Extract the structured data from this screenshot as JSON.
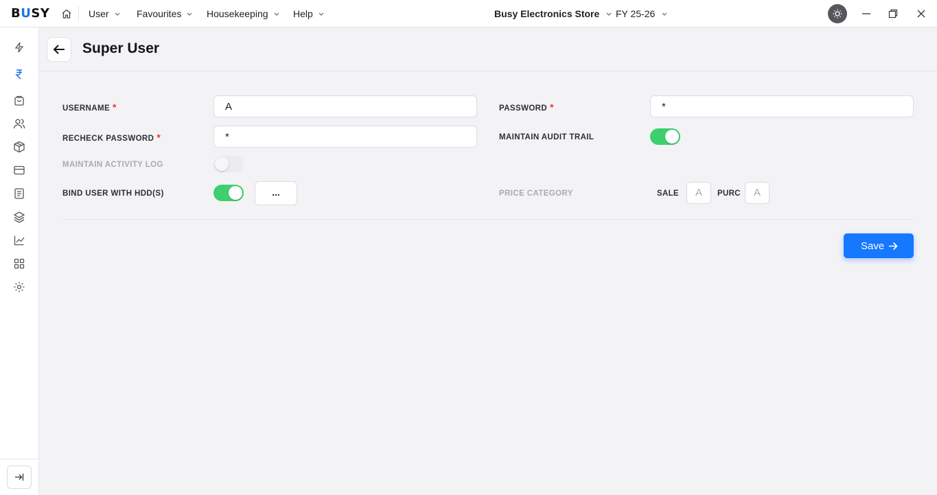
{
  "app": {
    "logo_prefix": "B",
    "logo_highlight": "U",
    "logo_suffix": "SY"
  },
  "menu": {
    "items": [
      {
        "label": "User"
      },
      {
        "label": "Favourites"
      },
      {
        "label": "Housekeeping"
      },
      {
        "label": "Help"
      }
    ],
    "company": "Busy Electronics Store",
    "fiscal_year": "FY 25-26"
  },
  "sidebar": {
    "icons": [
      "flash-icon",
      "rupee-icon",
      "shopping-bag-icon",
      "users-icon",
      "box-icon",
      "card-icon",
      "document-icon",
      "layers-icon",
      "chart-icon",
      "grid-icon",
      "gear-icon"
    ],
    "accent": "#1a73e8"
  },
  "page": {
    "title": "Super User"
  },
  "form": {
    "username": {
      "label": "USERNAME",
      "required_mark": "*",
      "value": "A"
    },
    "password": {
      "label": "PASSWORD",
      "required_mark": "*",
      "value": "*"
    },
    "recheck_password": {
      "label": "RECHECK PASSWORD",
      "required_mark": "*",
      "value": "*"
    },
    "audit_trail": {
      "label": "MAINTAIN AUDIT TRAIL",
      "enabled": true
    },
    "activity_log": {
      "label": "MAINTAIN ACTIVITY LOG",
      "enabled": false,
      "disabled": true
    },
    "bind_hdd": {
      "label": "BIND USER WITH HDD(S)",
      "enabled": true,
      "button_label": "..."
    },
    "price_category": {
      "label": "PRICE CATEGORY",
      "sale_label": "SALE",
      "sale_value": "A",
      "purc_label": "PURC",
      "purc_value": "A"
    }
  },
  "actions": {
    "save_label": "Save"
  },
  "colors": {
    "primary": "#1677ff",
    "toggle_on": "#3ecf6e",
    "required": "#e53935"
  }
}
